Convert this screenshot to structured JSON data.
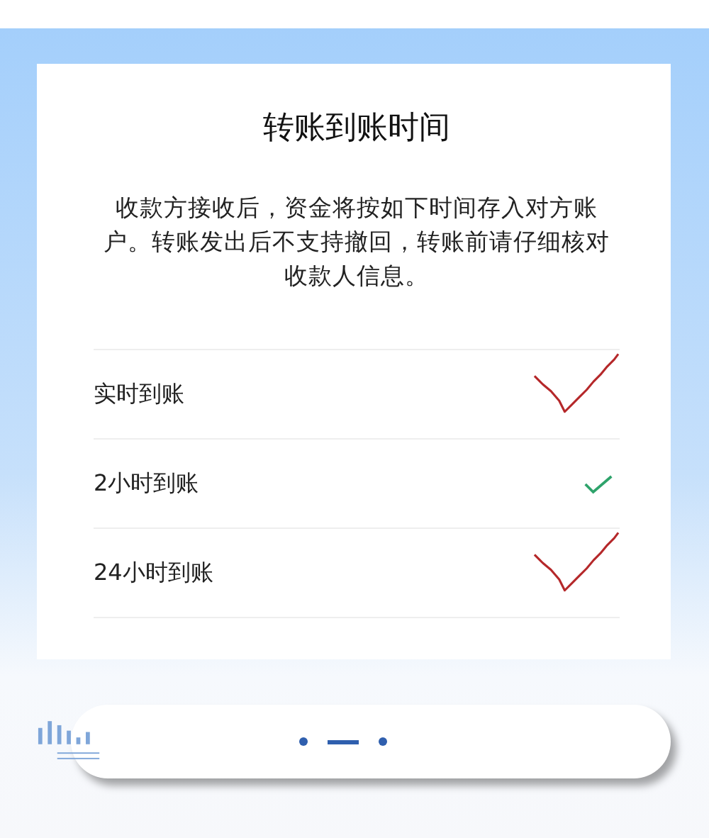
{
  "dialog": {
    "title": "转账到账时间",
    "description": "收款方接收后，资金将按如下时间存入对方账户。转账发出后不支持撤回，转账前请仔细核对收款人信息。"
  },
  "options": [
    {
      "label": "实时到账",
      "selected": false,
      "annotated": true
    },
    {
      "label": "2小时到账",
      "selected": true,
      "annotated": false
    },
    {
      "label": "24小时到账",
      "selected": false,
      "annotated": true
    }
  ],
  "pager": [
    {
      "selected": false
    },
    {
      "selected": true
    },
    {
      "selected": false
    }
  ]
}
